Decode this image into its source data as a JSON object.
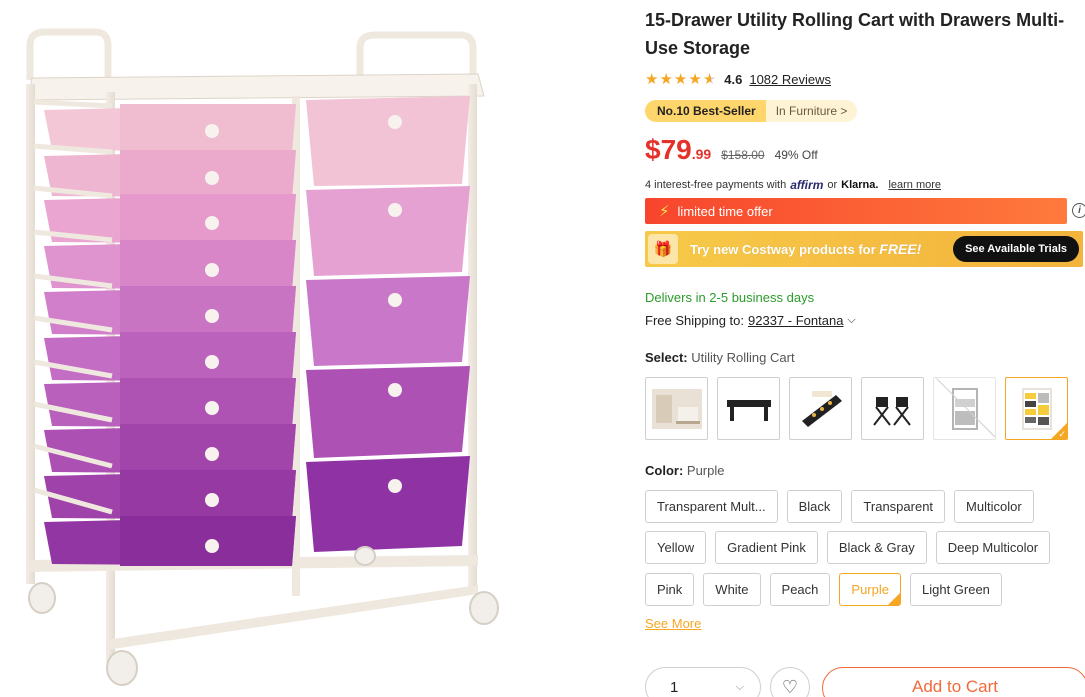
{
  "product": {
    "title": "15-Drawer Utility Rolling Cart with Drawers Multi-Use Storage",
    "rating": "4.6",
    "stars_value": 4.6,
    "reviews": "1082 Reviews"
  },
  "badges": {
    "bestseller": "No.10 Best-Seller",
    "category": "In Furniture >"
  },
  "price": {
    "main": "$79",
    "cents": ".99",
    "original": "$158.00",
    "discount": "49% Off"
  },
  "installment": {
    "text": "4 interest-free payments with",
    "affirm": "affirm",
    "or": "or",
    "klarna": "Klarna.",
    "learn_more": "learn more"
  },
  "promo": {
    "limited": "limited time offer",
    "trial_text": "Try new Costway products for",
    "trial_free": "FREE!",
    "trial_button": "See Available Trials"
  },
  "delivery": {
    "delivers": "Delivers in 2-5 business days",
    "shipping_label": "Free Shipping to:",
    "zip": "92337 - Fontana"
  },
  "select": {
    "label": "Select:",
    "value": "Utility Rolling Cart"
  },
  "color": {
    "label": "Color:",
    "value": "Purple",
    "rows": [
      [
        "Transparent Mult...",
        "Black",
        "Transparent",
        "Multicolor"
      ],
      [
        "Yellow",
        "Gradient Pink",
        "Black & Gray",
        "Deep Multicolor"
      ],
      [
        "Pink",
        "White",
        "Peach",
        "Purple",
        "Light Green"
      ]
    ],
    "selected": "Purple",
    "see_more": "See More"
  },
  "cart": {
    "quantity": "1",
    "add_label": "Add to Cart"
  },
  "colors": {
    "accent": "#f5a623",
    "price_red": "#e4322b",
    "delivery_green": "#2a9d2a",
    "cart_orange": "#f26a3a"
  },
  "icons": {
    "star": "★",
    "bolt": "⚡",
    "info": "i",
    "chevron_down": "⌵",
    "heart": "♡",
    "check": "✓",
    "gift": "🎁"
  }
}
